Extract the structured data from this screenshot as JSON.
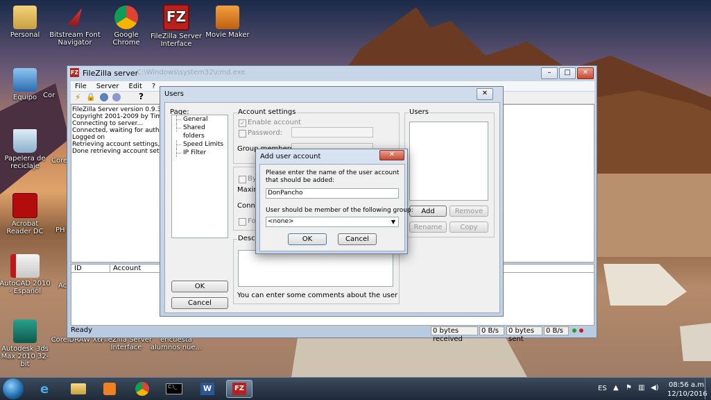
{
  "desktop": {
    "icons": [
      {
        "id": "personal",
        "label": "Personal"
      },
      {
        "id": "bitstream",
        "label": "Bitstream Font Navigator"
      },
      {
        "id": "chrome",
        "label": "Google Chrome"
      },
      {
        "id": "filezilla-if",
        "label": "FileZilla Server Interface"
      },
      {
        "id": "moviemaker",
        "label": "Movie Maker"
      },
      {
        "id": "equipo",
        "label": "Equipo"
      },
      {
        "id": "papelera",
        "label": "Papelera de reciclaje"
      },
      {
        "id": "acrobat",
        "label": "Acrobat Reader DC"
      },
      {
        "id": "autocad",
        "label": "AutoCAD 2010 - Español"
      },
      {
        "id": "3ds",
        "label": "Autodesk 3ds Max 2010 32-bit"
      },
      {
        "id": "corel",
        "label": "CorelDRAW X6"
      },
      {
        "id": "fz-bottom",
        "label": "FileZilla Server Interface"
      },
      {
        "id": "encuesta",
        "label": "encuesta alumnos nue..."
      }
    ],
    "partial_labels": {
      "cor1": "Cor",
      "cor2": "Core",
      "ph": "PH",
      "ac": "Ac"
    }
  },
  "main_window": {
    "title": "FileZilla server",
    "title_suffix": "C:\\Windows\\system32\\cmd.exe",
    "menu": [
      "File",
      "Server",
      "Edit",
      "?"
    ],
    "log_lines": [
      "FileZilla Server version 0.9.32 beta",
      "Copyright 2001-2009 by Tim Kosse (tim.kosse@filezilla-project.org)",
      "Connecting to server...",
      "Connected, waiting for authentication",
      "Logged on",
      "Retrieving account settings, please wait...",
      "Done retrieving account settings"
    ],
    "columns": {
      "id": "ID",
      "account": "Account"
    },
    "status": {
      "ready": "Ready",
      "received": "0 bytes received",
      "recv_rate": "0 B/s",
      "sent": "0 bytes sent",
      "sent_rate": "0 B/s"
    }
  },
  "users_dialog": {
    "title": "Users",
    "page_label": "Page:",
    "pages": [
      "General",
      "Shared folders",
      "Speed Limits",
      "IP Filter"
    ],
    "account_settings": "Account settings",
    "enable_account": "Enable account",
    "password": "Password:",
    "group_membership": "Group membership:",
    "bypass": "Byp",
    "maximum": "Maximu",
    "connections": "Conne",
    "force": "For",
    "description": "Descrip",
    "comment_hint": "You can enter some comments about the user",
    "users_group": "Users",
    "add": "Add",
    "remove": "Remove",
    "rename": "Rename",
    "copy": "Copy",
    "ok": "OK",
    "cancel": "Cancel"
  },
  "add_user_dialog": {
    "title": "Add user account",
    "prompt": "Please enter the name of the user account that should be added:",
    "name_value": "DonPancho",
    "group_prompt": "User should be member of the following group:",
    "group_value": "<none>",
    "ok": "OK",
    "cancel": "Cancel"
  },
  "taskbar": {
    "lang": "ES",
    "time": "08:56 a.m.",
    "date": "12/10/2016"
  }
}
